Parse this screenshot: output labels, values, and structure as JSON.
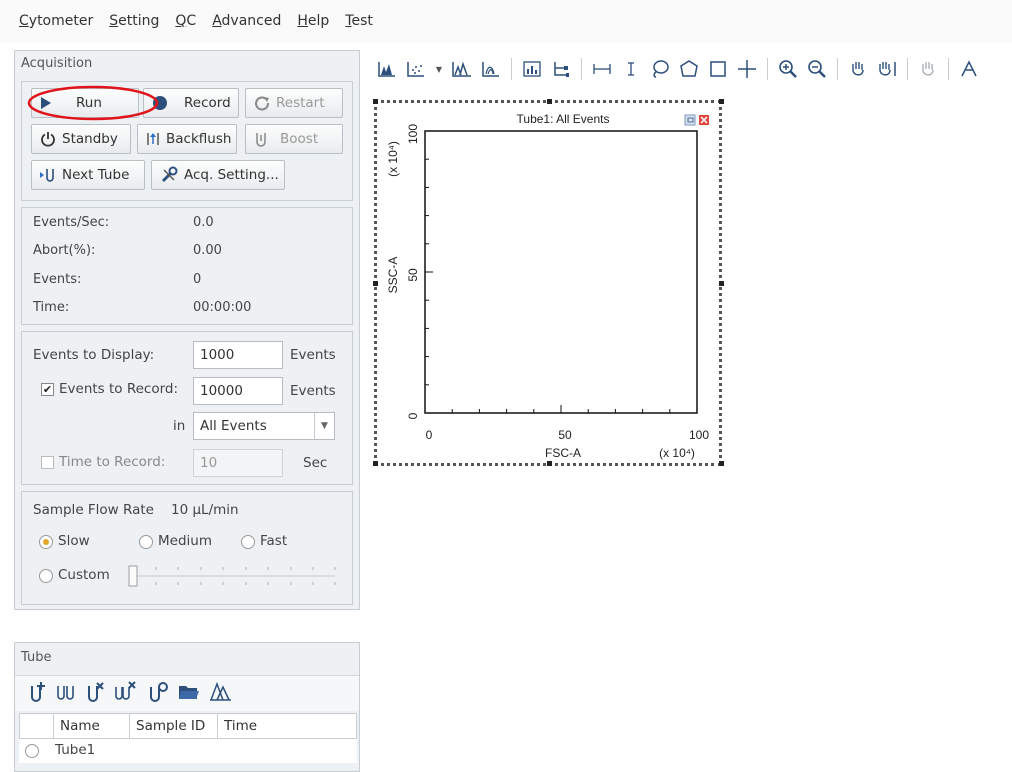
{
  "menu": [
    {
      "pre": "",
      "ul": "C",
      "post": "ytometer"
    },
    {
      "pre": "",
      "ul": "S",
      "post": "etting"
    },
    {
      "pre": "",
      "ul": "Q",
      "post": "C"
    },
    {
      "pre": "",
      "ul": "A",
      "post": "dvanced"
    },
    {
      "pre": "",
      "ul": "H",
      "post": "elp"
    },
    {
      "pre": "",
      "ul": "T",
      "post": "est"
    }
  ],
  "acquisition": {
    "title": "Acquisition",
    "buttons": {
      "run": "Run",
      "record": "Record",
      "restart": "Restart",
      "standby": "Standby",
      "backflush": "Backflush",
      "boost": "Boost",
      "next_tube": "Next Tube",
      "acq_setting": "Acq. Setting..."
    },
    "stats": {
      "events_sec_label": "Events/Sec:",
      "events_sec_value": "0.0",
      "abort_label": "Abort(%):",
      "abort_value": "0.00",
      "events_label": "Events:",
      "events_value": "0",
      "time_label": "Time:",
      "time_value": "00:00:00"
    },
    "display": {
      "events_to_display_label": "Events to Display:",
      "events_to_display_value": "1000",
      "events_unit": "Events",
      "events_to_record_label": "Events to Record:",
      "events_to_record_value": "10000",
      "events_to_record_checked": "✔",
      "in_label": "in",
      "in_value": "All Events",
      "time_to_record_label": "Time to Record:",
      "time_to_record_value": "10",
      "sec_unit": "Sec"
    },
    "flow": {
      "label": "Sample Flow Rate",
      "value": "10 µL/min",
      "slow": "Slow",
      "medium": "Medium",
      "fast": "Fast",
      "custom": "Custom",
      "selected": "Slow"
    }
  },
  "tube": {
    "title": "Tube",
    "columns": [
      "Name",
      "Sample ID",
      "Time"
    ],
    "rows": [
      {
        "name": "Tube1"
      }
    ]
  },
  "plot": {
    "title": "Tube1: All Events",
    "xlabel": "FSC-A",
    "ylabel": "SSC-A",
    "x_ticks": [
      "0",
      "50",
      "100"
    ],
    "y_ticks": [
      "0",
      "50",
      "100"
    ],
    "x_scale": "(x 10⁴)",
    "y_scale": "(x 10⁴)"
  },
  "colors": {
    "highlight_ellipse": "#e0141a",
    "close_button": "#e0463c",
    "radio_selected": "#e4a72a"
  }
}
